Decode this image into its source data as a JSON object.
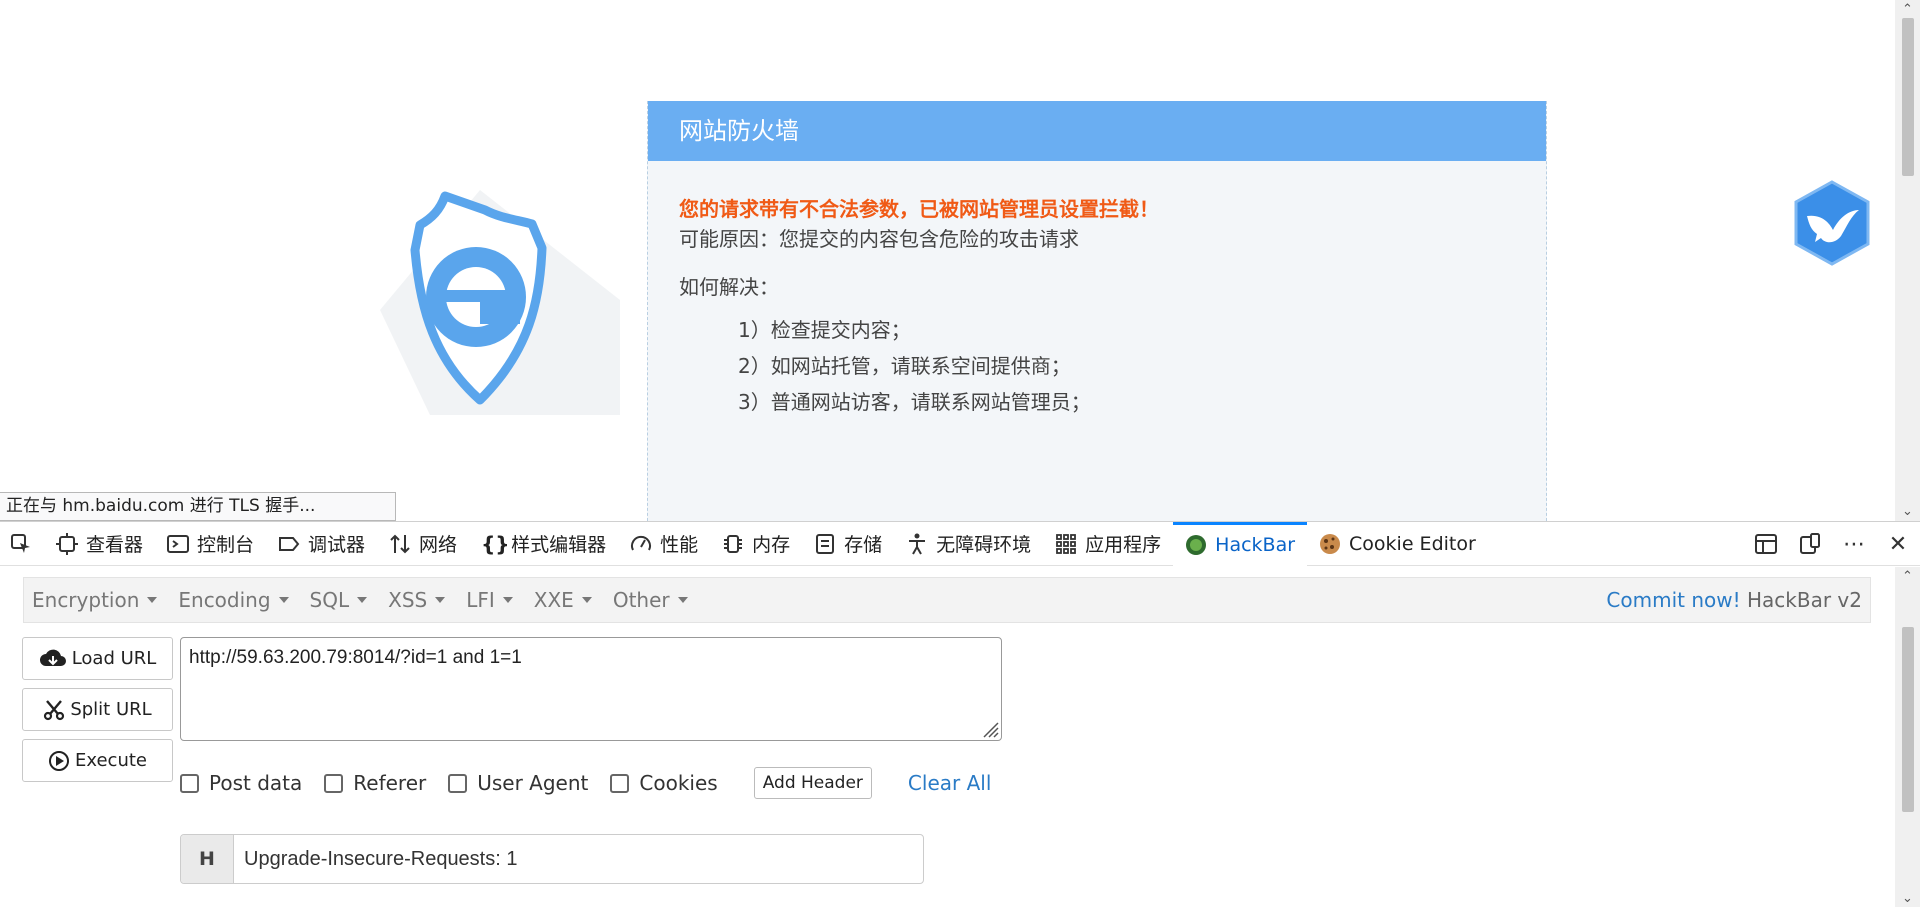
{
  "firewall": {
    "title": "网站防火墙",
    "warning": "您的请求带有不合法参数，已被网站管理员设置拦截！",
    "reason": "可能原因：您提交的内容包含危险的攻击请求",
    "how_title": "如何解决：",
    "steps": [
      "1）检查提交内容；",
      "2）如网站托管，请联系空间提供商；",
      "3）普通网站访客，请联系网站管理员；"
    ]
  },
  "status_bar": {
    "text": "正在与 hm.baidu.com 进行 TLS 握手..."
  },
  "devtools": {
    "tabs": [
      {
        "label": "查看器",
        "icon": "inspector-icon"
      },
      {
        "label": "控制台",
        "icon": "console-icon"
      },
      {
        "label": "调试器",
        "icon": "debugger-icon"
      },
      {
        "label": "网络",
        "icon": "network-icon"
      },
      {
        "label": "样式编辑器",
        "icon": "style-editor-icon"
      },
      {
        "label": "性能",
        "icon": "performance-icon"
      },
      {
        "label": "内存",
        "icon": "memory-icon"
      },
      {
        "label": "存储",
        "icon": "storage-icon"
      },
      {
        "label": "无障碍环境",
        "icon": "accessibility-icon"
      },
      {
        "label": "应用程序",
        "icon": "application-icon"
      },
      {
        "label": "HackBar",
        "icon": "hackbar-icon",
        "active": true
      },
      {
        "label": "Cookie Editor",
        "icon": "cookie-icon"
      }
    ]
  },
  "hackbar": {
    "menu": [
      "Encryption",
      "Encoding",
      "SQL",
      "XSS",
      "LFI",
      "XXE",
      "Other"
    ],
    "commit_link": "Commit now!",
    "brand": "HackBar v2",
    "load_url": "Load URL",
    "split_url": "Split URL",
    "execute": "Execute",
    "url_value": "http://59.63.200.79:8014/?id=1 and 1=1",
    "options": [
      "Post data",
      "Referer",
      "User Agent",
      "Cookies"
    ],
    "add_header": "Add Header",
    "clear_all": "Clear All",
    "header_tag": "H",
    "header_value": "Upgrade-Insecure-Requests: 1"
  },
  "colors": {
    "firewall_header": "#6aaef2",
    "warning": "#f05a16",
    "active_tab": "#0a64c8",
    "link": "#2a7bc6"
  }
}
